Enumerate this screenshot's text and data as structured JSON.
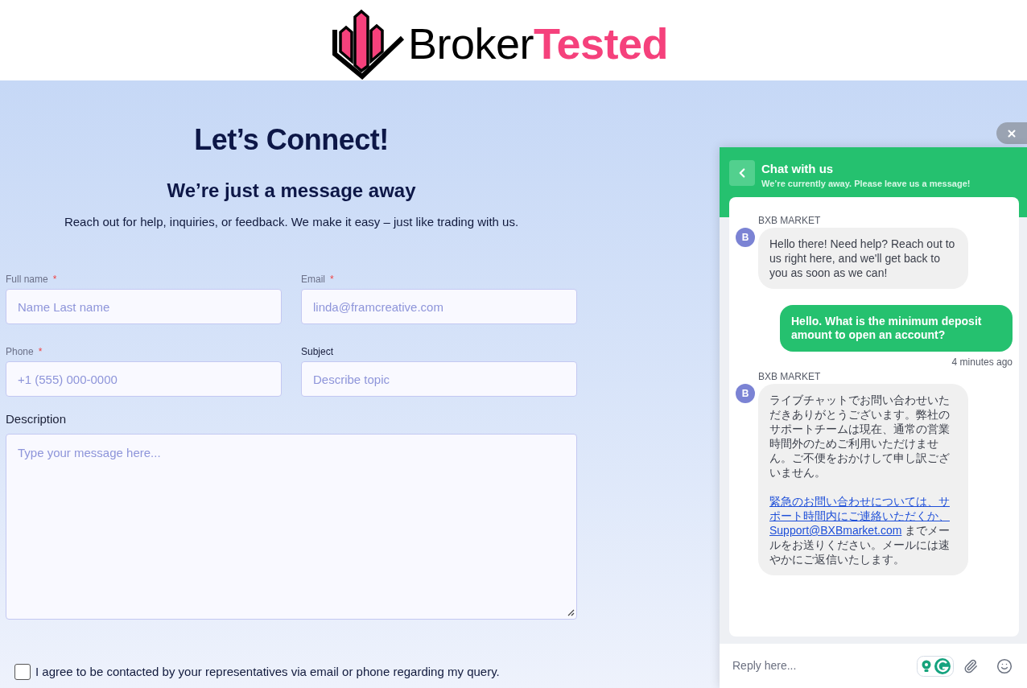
{
  "header": {
    "logo": {
      "word_1": "Broker",
      "word_2": "Tested"
    }
  },
  "intro": {
    "title": "Let’s Connect!",
    "subtitle": "We’re just a message away",
    "text": "Reach out for help, inquiries, or feedback. We make it easy – just like trading with us."
  },
  "form": {
    "fields": [
      {
        "label": "Full name",
        "marker": "*",
        "placeholder": "Name Last name"
      },
      {
        "label": "Email",
        "marker": "*",
        "placeholder": "linda@framcreative.com"
      },
      {
        "label": "Phone",
        "marker": "*",
        "placeholder": "+1 (555) 000-0000"
      },
      {
        "label": "Subject",
        "placeholder": "Describe topic"
      }
    ],
    "description": {
      "label": "Description",
      "placeholder": "Type your message here..."
    },
    "consent": {
      "label": "I agree to be contacted by your representatives via email or phone regarding my query.",
      "checked": false
    }
  },
  "chat": {
    "title": "Chat with us",
    "status": "We’re currently away. Please leave us a message!",
    "messages": [
      {
        "kind": "agent",
        "sender": "BXB MARKET",
        "avatar": "B",
        "paragraphs": [
          {
            "segments": [
              {
                "text": "Hello there! Need help? Reach out to us right here, and we'll get back to you as soon as we can!",
                "link": false
              }
            ]
          }
        ]
      },
      {
        "kind": "visitor",
        "text": "Hello. What is the minimum deposit amount to open an account?",
        "time": "4 minutes ago"
      },
      {
        "kind": "agent",
        "sender": "BXB MARKET",
        "avatar": "B",
        "paragraphs": [
          {
            "segments": [
              {
                "text": "ライブチャットでお問い合わせいただきありがとうございます。弊社のサポートチームは現在、通常の営業時間外のためご利用いただけません。ご不便をおかけして申し訳ございません。",
                "link": false
              }
            ]
          },
          {
            "segments": [
              {
                "text": "緊急のお問い合わせについては、サ",
                "link": true
              },
              {
                "text": "ポート時間内にご連絡いただくか、",
                "link": true
              },
              {
                "text": "Support@BXBmarket.com",
                "link": true
              },
              {
                "text": " までメールをお送りください。メールには速やかにご返信いたします。",
                "link": false
              }
            ]
          }
        ]
      }
    ],
    "reply": {
      "placeholder": "Reply here..."
    }
  }
}
